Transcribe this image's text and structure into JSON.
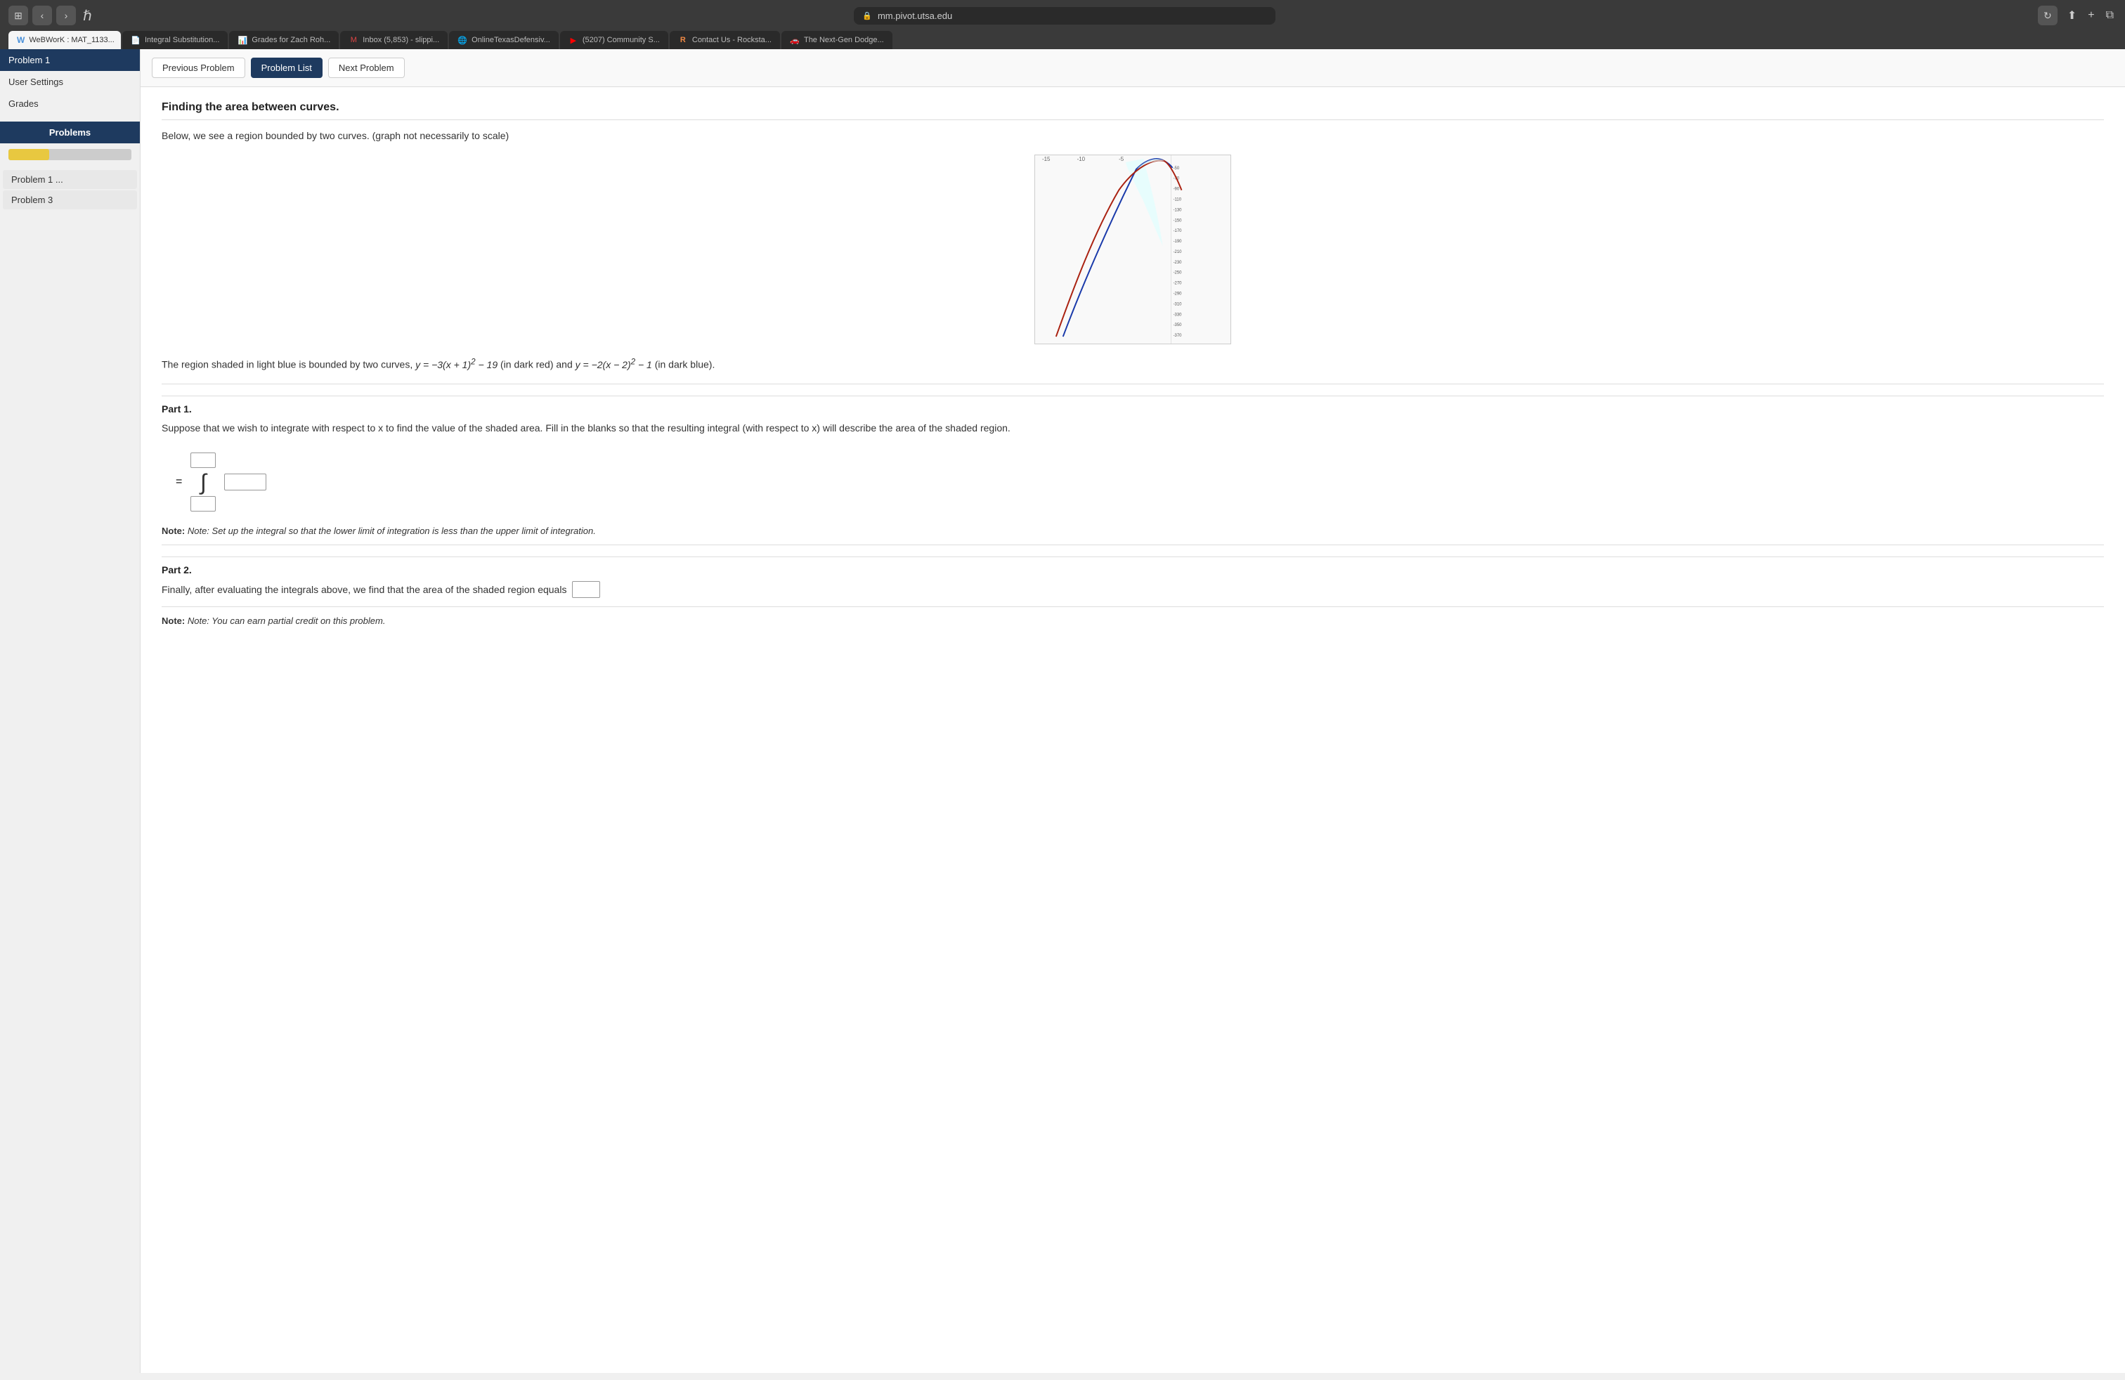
{
  "browser": {
    "url": "mm.pivot.utsa.edu",
    "tabs": [
      {
        "id": "webwork",
        "label": "WeBWorK : MAT_1133...",
        "active": true,
        "favicon": "W"
      },
      {
        "id": "integral",
        "label": "Integral Substitution...",
        "active": false,
        "favicon": "📄"
      },
      {
        "id": "grades",
        "label": "Grades for Zach Roh...",
        "active": false,
        "favicon": "📊"
      },
      {
        "id": "inbox",
        "label": "Inbox (5,853) - slippi...",
        "active": false,
        "favicon": "M"
      },
      {
        "id": "texas",
        "label": "OnlineTexasDefensiv...",
        "active": false,
        "favicon": "🌐"
      },
      {
        "id": "community",
        "label": "(5207) Community S...",
        "active": false,
        "favicon": "▶"
      },
      {
        "id": "contact",
        "label": "Contact Us - Rocksta...",
        "active": false,
        "favicon": "R"
      },
      {
        "id": "dodge",
        "label": "The Next-Gen Dodge...",
        "active": false,
        "favicon": "🚗"
      }
    ]
  },
  "sidebar": {
    "active_item": "Problem 1",
    "menu_items": [
      {
        "label": "User Settings"
      },
      {
        "label": "Grades"
      }
    ],
    "section_title": "Problems",
    "progress": 33,
    "problem_items": [
      {
        "label": "Problem 1 ..."
      },
      {
        "label": "Problem 3"
      }
    ]
  },
  "nav_buttons": {
    "previous": "Previous Problem",
    "list": "Problem List",
    "next": "Next Problem"
  },
  "problem": {
    "title": "Finding the area between curves.",
    "intro": "Below, we see a region bounded by two curves. (graph not necessarily to scale)",
    "description": "The region shaded in light blue is bounded by two curves,",
    "curve1": "y = −3(x + 1)² − 19",
    "curve1_label": "(in dark red)",
    "curve2": "y = −2(x − 2)² − 1",
    "curve2_label": "(in dark blue).",
    "part1": {
      "title": "Part 1.",
      "description": "Suppose that we wish to integrate with respect to x to find the value of the shaded area. Fill in the blanks so that the resulting integral (with respect to x) will describe the area of the shaded region.",
      "note": "Note: Set up the integral so that the lower limit of integration is less than the upper limit of integration."
    },
    "part2": {
      "title": "Part 2.",
      "description": "Finally, after evaluating the integrals above, we find that the area of the shaded region equals",
      "note": "Note: You can earn partial credit on this problem."
    }
  }
}
